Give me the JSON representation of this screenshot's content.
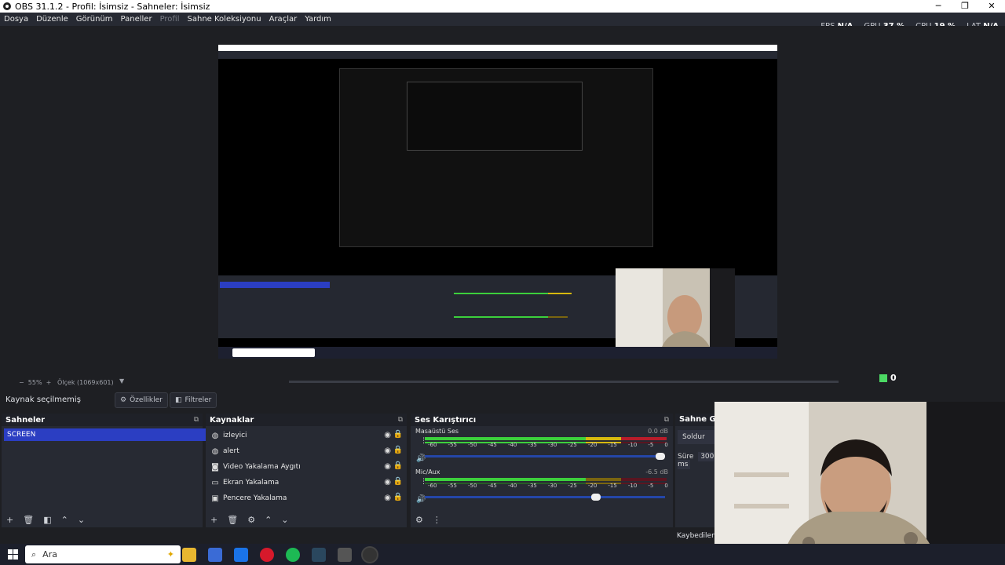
{
  "window": {
    "title": "OBS 31.1.2 - Profil: İsimsiz - Sahneler: İsimsiz"
  },
  "menu": [
    "Dosya",
    "Düzenle",
    "Görünüm",
    "Paneller",
    "Profil",
    "Sahne Koleksiyonu",
    "Araçlar",
    "Yardım"
  ],
  "stats": {
    "fps_label": "FPS",
    "fps": "N/A",
    "gpu_label": "GPU",
    "gpu": "37 %",
    "cpu_label": "CPU",
    "cpu": "19 %",
    "lat_label": "LAT",
    "lat": "N/A"
  },
  "zoom": {
    "percent": "55%",
    "scale": "Ölçek (1069x601)"
  },
  "badge_count": "0",
  "source_toolbar": {
    "no_source": "Kaynak seçilmemiş",
    "properties": "Özellikler",
    "filters": "Filtreler"
  },
  "scenes": {
    "title": "Sahneler",
    "items": [
      "SCREEN"
    ]
  },
  "sources": {
    "title": "Kaynaklar",
    "items": [
      {
        "label": "izleyici",
        "icon": "globe-icon"
      },
      {
        "label": "alert",
        "icon": "globe-icon"
      },
      {
        "label": "Video Yakalama Aygıtı",
        "icon": "camera-icon"
      },
      {
        "label": "Ekran Yakalama",
        "icon": "monitor-icon"
      },
      {
        "label": "Pencere Yakalama",
        "icon": "window-icon"
      }
    ]
  },
  "mixer": {
    "title": "Ses Karıştırıcı",
    "ticks": [
      "-60",
      "-55",
      "-50",
      "-45",
      "-40",
      "-35",
      "-30",
      "-25",
      "-20",
      "-15",
      "-10",
      "-5",
      "0"
    ],
    "channels": [
      {
        "name": "Masaüstü Ses",
        "db": "0.0 dB",
        "level": 1.0
      },
      {
        "name": "Mic/Aux",
        "db": "-6.5 dB",
        "level": 0.72
      }
    ]
  },
  "transitions": {
    "title": "Sahne Geçişleri",
    "type": "Soldur",
    "duration_label": "Süre",
    "duration": "300 ms"
  },
  "status": {
    "lost_frames": "Kaybedilen Kareler"
  },
  "taskbar": {
    "search_placeholder": "Ara"
  },
  "colors": {
    "accent": "#2b3ec2",
    "meter_green": "#3cd03c",
    "meter_yellow": "#d7b90e",
    "meter_red": "#b81c2a"
  }
}
